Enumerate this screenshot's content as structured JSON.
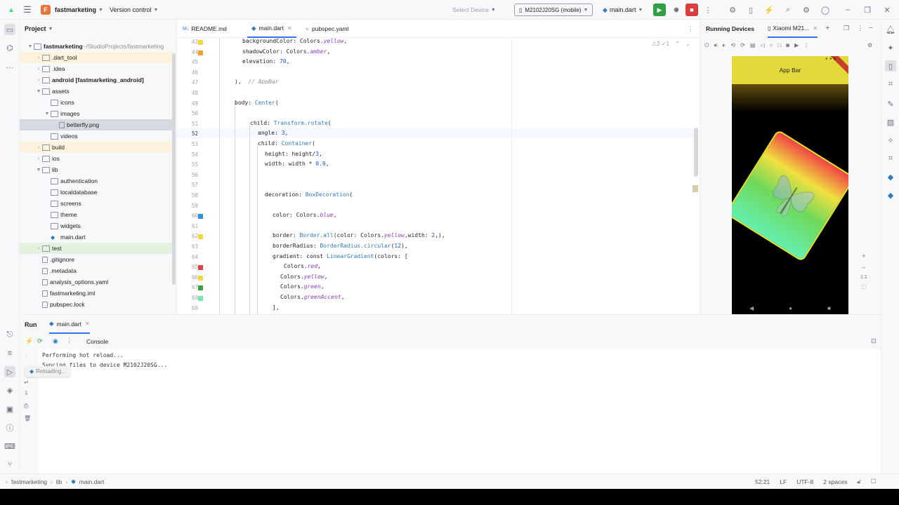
{
  "titlebar": {
    "project_initial": "F",
    "project_name": "fastmarketing",
    "vcs_label": "Version control",
    "select_device_label": "Select Device",
    "device_label": "M2102J20SG (mobile)",
    "run_config_label": "main.dart"
  },
  "project": {
    "title": "Project",
    "items": [
      {
        "label": "fastmarketing",
        "suffix": "~/StudioProjects/fastmarketing"
      },
      {
        "label": ".dart_tool"
      },
      {
        "label": ".idea"
      },
      {
        "label": "android [fastmarketing_android]"
      },
      {
        "label": "assets"
      },
      {
        "label": "icons"
      },
      {
        "label": "images"
      },
      {
        "label": "betterfly.png"
      },
      {
        "label": "videos"
      },
      {
        "label": "build"
      },
      {
        "label": "ios"
      },
      {
        "label": "lib"
      },
      {
        "label": "authentication"
      },
      {
        "label": "localdatabase"
      },
      {
        "label": "screens"
      },
      {
        "label": "theme"
      },
      {
        "label": "widgets"
      },
      {
        "label": "main.dart"
      },
      {
        "label": "test"
      },
      {
        "label": ".gitignore"
      },
      {
        "label": ".metadata"
      },
      {
        "label": "analysis_options.yaml"
      },
      {
        "label": "fastmarketing.iml"
      },
      {
        "label": "pubspec.lock"
      }
    ]
  },
  "editor": {
    "tabs": [
      {
        "label": "README.md",
        "icon": "M↓"
      },
      {
        "label": "main.dart"
      },
      {
        "label": "pubspec.yaml"
      }
    ],
    "inspection": "⚠2 ✓1",
    "lines": [
      {
        "n": "43",
        "parts": [
          [
            "kw",
            "backgroundColor: Colors."
          ],
          [
            "fld",
            "yellow"
          ],
          [
            "kw",
            ","
          ]
        ]
      },
      {
        "n": "44",
        "parts": [
          [
            "kw",
            "shadowColor: Colors."
          ],
          [
            "fld",
            "amber"
          ],
          [
            "kw",
            ","
          ]
        ]
      },
      {
        "n": "45",
        "parts": [
          [
            "kw",
            "elevation: "
          ],
          [
            "num",
            "70"
          ],
          [
            "kw",
            ","
          ]
        ]
      },
      {
        "n": "46",
        "parts": []
      },
      {
        "n": "47",
        "parts": [
          [
            "kw",
            "),  "
          ],
          [
            "cmt",
            "// AppBar"
          ]
        ]
      },
      {
        "n": "48",
        "parts": []
      },
      {
        "n": "49",
        "parts": [
          [
            "kw",
            "body: "
          ],
          [
            "cls",
            "Center"
          ],
          [
            "kw",
            "("
          ]
        ]
      },
      {
        "n": "50",
        "parts": []
      },
      {
        "n": "51",
        "parts": [
          [
            "kw",
            "child: "
          ],
          [
            "cls",
            "Transform.rotate"
          ],
          [
            "kw",
            "("
          ]
        ]
      },
      {
        "n": "52",
        "parts": [
          [
            "kw",
            "angle: "
          ],
          [
            "num",
            "3"
          ],
          [
            "kw",
            ","
          ]
        ]
      },
      {
        "n": "53",
        "parts": [
          [
            "kw",
            "child: "
          ],
          [
            "cls",
            "Container"
          ],
          [
            "kw",
            "("
          ]
        ]
      },
      {
        "n": "54",
        "parts": [
          [
            "kw",
            "height: height/"
          ],
          [
            "num",
            "3"
          ],
          [
            "kw",
            ","
          ]
        ]
      },
      {
        "n": "55",
        "parts": [
          [
            "kw",
            "width: width * "
          ],
          [
            "num",
            "0.9"
          ],
          [
            "kw",
            ","
          ]
        ]
      },
      {
        "n": "56",
        "parts": []
      },
      {
        "n": "57",
        "parts": []
      },
      {
        "n": "58",
        "parts": [
          [
            "kw",
            "decoration: "
          ],
          [
            "cls",
            "BoxDecoration"
          ],
          [
            "kw",
            "("
          ]
        ]
      },
      {
        "n": "59",
        "parts": []
      },
      {
        "n": "60",
        "parts": [
          [
            "kw",
            "color: Colors."
          ],
          [
            "fld",
            "blue"
          ],
          [
            "kw",
            ","
          ]
        ]
      },
      {
        "n": "61",
        "parts": []
      },
      {
        "n": "62",
        "parts": [
          [
            "kw",
            "border: "
          ],
          [
            "cls",
            "Border.all"
          ],
          [
            "kw",
            "(color: Colors."
          ],
          [
            "fld",
            "yellow"
          ],
          [
            "kw",
            ",width: "
          ],
          [
            "num",
            "2"
          ],
          [
            "kw",
            ",),"
          ]
        ]
      },
      {
        "n": "63",
        "parts": [
          [
            "kw",
            "borderRadius: "
          ],
          [
            "cls",
            "BorderRadius.circular"
          ],
          [
            "kw",
            "("
          ],
          [
            "num",
            "12"
          ],
          [
            "kw",
            "),"
          ]
        ]
      },
      {
        "n": "64",
        "parts": [
          [
            "kw",
            "gradient: const "
          ],
          [
            "cls",
            "LinearGradient"
          ],
          [
            "kw",
            "(colors: ["
          ]
        ]
      },
      {
        "n": "65",
        "parts": [
          [
            "kw",
            "Colors."
          ],
          [
            "fld",
            "red"
          ],
          [
            "kw",
            ","
          ]
        ]
      },
      {
        "n": "66",
        "parts": [
          [
            "kw",
            "Colors."
          ],
          [
            "fld",
            "yellow"
          ],
          [
            "kw",
            ","
          ]
        ]
      },
      {
        "n": "67",
        "parts": [
          [
            "kw",
            "Colors."
          ],
          [
            "fld",
            "green"
          ],
          [
            "kw",
            ","
          ]
        ]
      },
      {
        "n": "68",
        "parts": [
          [
            "kw",
            "Colors."
          ],
          [
            "fld",
            "greenAccent"
          ],
          [
            "kw",
            ","
          ]
        ]
      },
      {
        "n": "69",
        "parts": [
          [
            "kw",
            "],"
          ]
        ]
      }
    ]
  },
  "device": {
    "tab_running": "Running Devices",
    "tab_device": "Xiaomi M21...",
    "app_bar_title": "App Bar",
    "zoom_label": "1:1"
  },
  "run": {
    "title": "Run",
    "config_tab": "main.dart",
    "console_tab": "Console",
    "console_lines": [
      "Performing hot reload...",
      "Syncing files to device M2102J20SG..."
    ],
    "tooltip": "Reloading..."
  },
  "status": {
    "crumbs": [
      "fastmarketing",
      "lib",
      "main.dart"
    ],
    "position": "52:21",
    "line_sep": "LF",
    "encoding": "UTF-8",
    "indent": "2 spaces"
  },
  "colors": {
    "accent": "#3574f0",
    "run_green": "#2ea043",
    "stop_red": "#d93c3c",
    "app_bar_yellow": "#e4d93a"
  }
}
